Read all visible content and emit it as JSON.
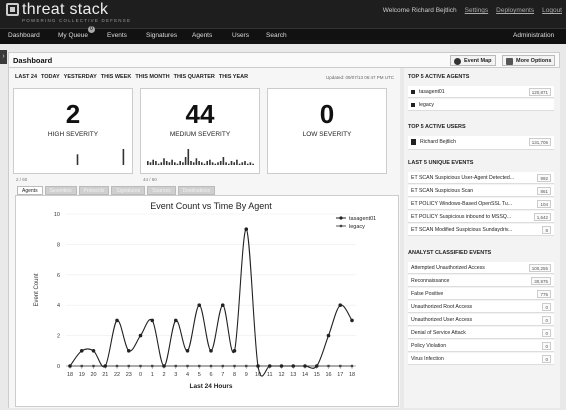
{
  "brand": {
    "name": "threat stack",
    "tagline": "POWERING COLLECTIVE DEFENSE"
  },
  "user_links": [
    "Welcome Richard Bejtlich",
    "Settings",
    "Deployments",
    "Logout"
  ],
  "nav": {
    "items": [
      "Dashboard",
      "My Queue",
      "Events",
      "Signatures",
      "Agents",
      "Users",
      "Search"
    ],
    "queue_badge": "0",
    "admin": "Administration"
  },
  "side_toggle": "›",
  "dashboard": {
    "title": "Dashboard",
    "event_map_label": "Event Map",
    "more_options_label": "More Options"
  },
  "time_filters": [
    "LAST 24",
    "TODAY",
    "YESTERDAY",
    "THIS WEEK",
    "THIS MONTH",
    "THIS QUARTER",
    "THIS YEAR"
  ],
  "updated": "Updated: 09/07/13 06:47 PM UTC",
  "severity_cards": [
    {
      "count": "2",
      "label": "HIGH SEVERITY",
      "footer": "2 / 60",
      "spark": [
        0,
        0,
        0,
        0,
        0,
        0,
        0,
        0,
        0,
        0,
        0,
        0,
        0,
        0,
        0,
        0,
        0,
        0,
        0,
        0,
        0,
        8,
        0,
        0,
        0,
        0,
        0,
        0,
        0,
        0,
        0,
        0,
        0,
        0,
        0,
        0,
        0,
        0,
        12,
        0
      ]
    },
    {
      "count": "44",
      "label": "MEDIUM SEVERITY",
      "footer": "44 / 60",
      "spark": [
        3,
        2,
        4,
        3,
        1,
        2,
        5,
        3,
        2,
        4,
        2,
        1,
        3,
        2,
        6,
        12,
        3,
        2,
        5,
        3,
        2,
        1,
        3,
        4,
        2,
        1,
        2,
        3,
        6,
        2,
        1,
        3,
        2,
        4,
        1,
        2,
        3,
        1,
        2,
        1
      ]
    },
    {
      "count": "0",
      "label": "LOW SEVERITY",
      "footer": "",
      "spark": []
    }
  ],
  "tabs": [
    "Agents",
    "Severities",
    "Protocols",
    "Signatures",
    "Sources",
    "Destinations"
  ],
  "chart_data": {
    "type": "line",
    "title": "Event Count vs Time By Agent",
    "xlabel": "Last 24 Hours",
    "ylabel": "Event Count",
    "ylim": [
      0,
      10
    ],
    "yticks": [
      0,
      2,
      4,
      6,
      8,
      10
    ],
    "categories": [
      "18",
      "19",
      "20",
      "21",
      "22",
      "23",
      "0",
      "1",
      "2",
      "3",
      "4",
      "5",
      "6",
      "7",
      "8",
      "9",
      "10",
      "11",
      "12",
      "13",
      "14",
      "15",
      "16",
      "17",
      "18"
    ],
    "series": [
      {
        "name": "tasagent01",
        "values": [
          0,
          1,
          1,
          0,
          3,
          1,
          2,
          3,
          0,
          3,
          1,
          4,
          1,
          4,
          1,
          9,
          0,
          0,
          0,
          0,
          0,
          0,
          2,
          4,
          3
        ]
      },
      {
        "name": "legacy",
        "values": [
          0,
          0,
          0,
          0,
          0,
          0,
          0,
          0,
          0,
          0,
          0,
          0,
          0,
          0,
          0,
          0,
          0,
          0,
          0,
          0,
          0,
          0,
          0,
          0,
          0
        ]
      }
    ],
    "legend": "top-right"
  },
  "top_agents": {
    "title": "TOP 5 ACTIVE AGENTS",
    "items": [
      {
        "name": "tasagent01",
        "value": "120,871"
      },
      {
        "name": "legacy",
        "value": "0"
      }
    ]
  },
  "top_users": {
    "title": "TOP 5 ACTIVE USERS",
    "items": [
      {
        "name": "Richard Bejtlich",
        "value": "131,705"
      }
    ]
  },
  "unique_events": {
    "title": "LAST 5 UNIQUE EVENTS",
    "items": [
      {
        "name": "ET SCAN Suspicious User-Agent Detected...",
        "value": "992"
      },
      {
        "name": "ET SCAN Suspicious Scan",
        "value": "861"
      },
      {
        "name": "ET POLICY Windows-Based OpenSSL Tu...",
        "value": "104"
      },
      {
        "name": "ET POLICY Suspicious inbound to MSSQ...",
        "value": "1,642"
      },
      {
        "name": "ET SCAN Modified Suspicious Sundaydriv...",
        "value": "8"
      }
    ]
  },
  "classified_events": {
    "title": "ANALYST CLASSIFIED EVENTS",
    "items": [
      {
        "name": "Attempted Unauthorized Access",
        "value": "100,255"
      },
      {
        "name": "Reconnaissance",
        "value": "30,975"
      },
      {
        "name": "False Positive",
        "value": "775"
      },
      {
        "name": "Unauthorized Root Access",
        "value": "0"
      },
      {
        "name": "Unauthorized User Access",
        "value": "0"
      },
      {
        "name": "Denial of Service Attack",
        "value": "0"
      },
      {
        "name": "Policy Violation",
        "value": "0"
      },
      {
        "name": "Virus Infection",
        "value": "0"
      }
    ]
  }
}
